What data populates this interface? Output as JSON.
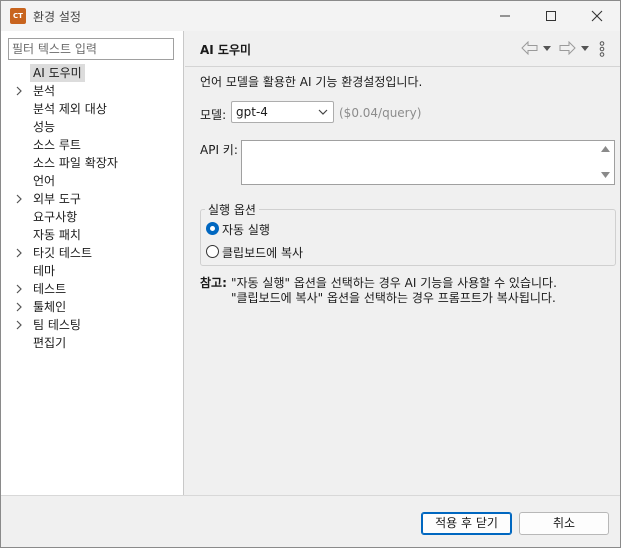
{
  "window": {
    "title": "환경 설정",
    "app_icon_text": "CT"
  },
  "filter": {
    "placeholder": "필터 텍스트 입력",
    "value": ""
  },
  "tree": {
    "items": [
      {
        "label": "AI 도우미",
        "expandable": false,
        "selected": true
      },
      {
        "label": "분석",
        "expandable": true,
        "selected": false
      },
      {
        "label": "분석 제외 대상",
        "expandable": false,
        "selected": false
      },
      {
        "label": "성능",
        "expandable": false,
        "selected": false
      },
      {
        "label": "소스 루트",
        "expandable": false,
        "selected": false
      },
      {
        "label": "소스 파일 확장자",
        "expandable": false,
        "selected": false
      },
      {
        "label": "언어",
        "expandable": false,
        "selected": false
      },
      {
        "label": "외부 도구",
        "expandable": true,
        "selected": false
      },
      {
        "label": "요구사항",
        "expandable": false,
        "selected": false
      },
      {
        "label": "자동 패치",
        "expandable": false,
        "selected": false
      },
      {
        "label": "타깃 테스트",
        "expandable": true,
        "selected": false
      },
      {
        "label": "테마",
        "expandable": false,
        "selected": false
      },
      {
        "label": "테스트",
        "expandable": true,
        "selected": false
      },
      {
        "label": "툴체인",
        "expandable": true,
        "selected": false
      },
      {
        "label": "팀 테스팅",
        "expandable": true,
        "selected": false
      },
      {
        "label": "편집기",
        "expandable": false,
        "selected": false
      }
    ]
  },
  "page": {
    "title": "AI 도우미",
    "description": "언어 모델을 활용한 AI 기능 환경설정입니다.",
    "model_label": "모델:",
    "model_value": "gpt-4",
    "model_price": "($0.04/query)",
    "apikey_label": "API 키:",
    "apikey_value": "",
    "group_title": "실행 옵션",
    "radio_options": [
      {
        "label": "자동 실행",
        "checked": true
      },
      {
        "label": "클립보드에 복사",
        "checked": false
      }
    ],
    "note_label": "참고:",
    "note_line1": "\"자동 실행\" 옵션을 선택하는 경우 AI 기능을 사용할 수 있습니다.",
    "note_line2": "\"클립보드에 복사\" 옵션을 선택하는 경우 프롬프트가 복사됩니다."
  },
  "footer": {
    "apply_close_label": "적용 후 닫기",
    "cancel_label": "취소"
  },
  "colors": {
    "accent": "#0067c0",
    "selection": "#dcdcdc",
    "price_text": "#8c8c8c"
  }
}
